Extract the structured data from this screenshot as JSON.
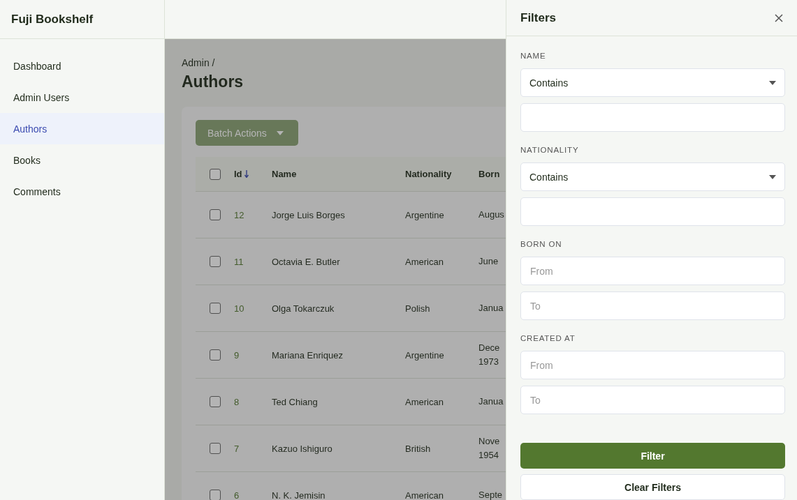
{
  "app": {
    "title": "Fuji Bookshelf"
  },
  "sidebar": {
    "items": [
      {
        "label": "Dashboard",
        "selected": false
      },
      {
        "label": "Admin Users",
        "selected": false
      },
      {
        "label": "Authors",
        "selected": true
      },
      {
        "label": "Books",
        "selected": false
      },
      {
        "label": "Comments",
        "selected": false
      }
    ]
  },
  "page": {
    "breadcrumb": "Admin /",
    "title": "Authors",
    "batch_button": "Batch Actions"
  },
  "table": {
    "all_selected": false,
    "columns": [
      "Id",
      "Name",
      "Nationality",
      "Born"
    ],
    "rows": [
      {
        "id": "12",
        "name": "Jorge Luis Borges",
        "nationality": "Argentine",
        "born": "Augus",
        "selected": false
      },
      {
        "id": "11",
        "name": "Octavia E. Butler",
        "nationality": "American",
        "born": "June",
        "selected": false
      },
      {
        "id": "10",
        "name": "Olga Tokarczuk",
        "nationality": "Polish",
        "born": "Janua",
        "selected": false
      },
      {
        "id": "9",
        "name": "Mariana Enriquez",
        "nationality": "Argentine",
        "born": "Dece\n1973",
        "selected": false
      },
      {
        "id": "8",
        "name": "Ted Chiang",
        "nationality": "American",
        "born": "Janua",
        "selected": false
      },
      {
        "id": "7",
        "name": "Kazuo Ishiguro",
        "nationality": "British",
        "born": "Nove\n1954",
        "selected": false
      },
      {
        "id": "6",
        "name": "N. K. Jemisin",
        "nationality": "American",
        "born": "Septe",
        "selected": false
      }
    ]
  },
  "filters": {
    "title": "Filters",
    "groups": [
      {
        "label": "NAME",
        "kind": "text",
        "operator": "Contains"
      },
      {
        "label": "NATIONALITY",
        "kind": "text",
        "operator": "Contains"
      },
      {
        "label": "BORN ON",
        "kind": "range",
        "from_placeholder": "From",
        "to_placeholder": "To"
      },
      {
        "label": "CREATED AT",
        "kind": "range",
        "from_placeholder": "From",
        "to_placeholder": "To"
      }
    ],
    "apply_button": "Filter",
    "clear_button": "Clear Filters"
  }
}
